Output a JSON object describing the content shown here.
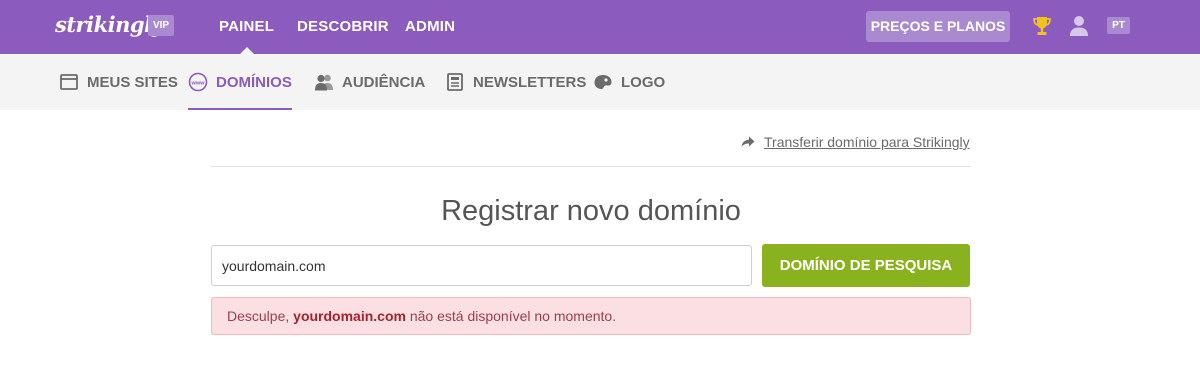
{
  "header": {
    "logo": "strikingly",
    "vip_badge": "VIP",
    "nav": [
      "PAINEL",
      "DESCOBRIR",
      "ADMIN"
    ],
    "plans_button": "PREÇOS E PLANOS",
    "language": "PT",
    "icons": [
      "trophy-icon",
      "user-icon"
    ]
  },
  "subnav": {
    "items": [
      {
        "label": "MEUS SITES",
        "icon": "window-icon"
      },
      {
        "label": "DOMÍNIOS",
        "icon": "www-icon",
        "active": true
      },
      {
        "label": "AUDIÊNCIA",
        "icon": "users-icon"
      },
      {
        "label": "NEWSLETTERS",
        "icon": "newsletter-icon"
      },
      {
        "label": "LOGO",
        "icon": "palette-icon"
      }
    ]
  },
  "main": {
    "transfer_link": "Transferir domínio para Strikingly",
    "title": "Registrar novo domínio",
    "search_value": "yourdomain.com",
    "search_button": "DOMÍNIO DE PESQUISA",
    "alert": {
      "prefix": "Desculpe,",
      "domain": "yourdomain.com",
      "suffix": "não está disponível no momento."
    }
  },
  "colors": {
    "brand_purple": "#8b5bbd",
    "accent_green": "#8ab21f",
    "alert_bg": "#fbdfe2",
    "trophy_yellow": "#f2c21f"
  }
}
